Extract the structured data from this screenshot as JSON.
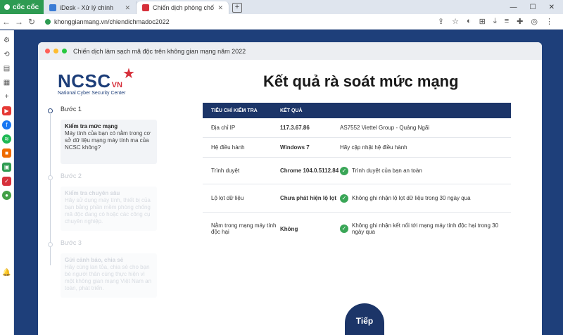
{
  "browser": {
    "brand": "cốc cốc",
    "tabs": [
      {
        "title": "iDesk - Xử lý chính",
        "color": "#3a7bd5"
      },
      {
        "title": "Chiến dịch phòng chống m...",
        "color": "#d6303b"
      }
    ],
    "url": "khonggianmang.vn/chiendichmadoc2022"
  },
  "card": {
    "window_title": "Chiến dịch làm sạch mã độc trên không gian mạng năm 2022"
  },
  "logo": {
    "word": "NCSC",
    "vn": "VN",
    "subtitle": "National Cyber Security Center"
  },
  "page_title": "Kết quả rà soát mức mạng",
  "steps": [
    {
      "label": "Bước 1",
      "box_title": "Kiểm tra mức mạng",
      "box_text": "Máy tính của bạn có nằm trong cơ sở dữ liệu mạng máy tính ma của NCSC không?"
    },
    {
      "label": "Bước 2",
      "box_title": "Kiểm tra chuyên sâu",
      "box_text": "Hãy sử dụng máy tính, thiết bị của bạn bằng phần mềm phòng chống mã độc đang có hoặc các công cụ chuyên nghiệp."
    },
    {
      "label": "Bước 3",
      "box_title": "Gửi cảnh báo, chia sẻ",
      "box_text": "Hãy cùng lan tỏa, chia sẻ cho bạn bè người thân cùng thực hiện vì một không gian mạng Việt Nam an toàn, phát triển."
    }
  ],
  "table": {
    "headers": [
      "TIÊU CHÍ KIỂM TRA",
      "KẾT QUẢ",
      ""
    ],
    "rows": [
      {
        "criterion": "Địa chỉ IP",
        "result": "117.3.67.86",
        "note": "AS7552 Viettel Group - Quảng Ngãi",
        "ok": false
      },
      {
        "criterion": "Hệ điều hành",
        "result": "Windows 7",
        "note": "Hãy cập nhật hệ điều hành",
        "ok": false
      },
      {
        "criterion": "Trình duyệt",
        "result": "Chrome 104.0.5112.84",
        "note": "Trình duyệt của bạn an toàn",
        "ok": true
      },
      {
        "criterion": "Lộ lọt dữ liệu",
        "result": "Chưa phát hiện lộ lọt",
        "note": "Không ghi nhận lộ lọt dữ liệu trong 30 ngày qua",
        "ok": true
      },
      {
        "criterion": "Nằm trong mạng máy tính độc hại",
        "result": "Không",
        "note": "Không ghi nhận kết nối tới mạng máy tính độc hại trong 30 ngày qua",
        "ok": true
      }
    ]
  },
  "next_button": "Tiếp"
}
